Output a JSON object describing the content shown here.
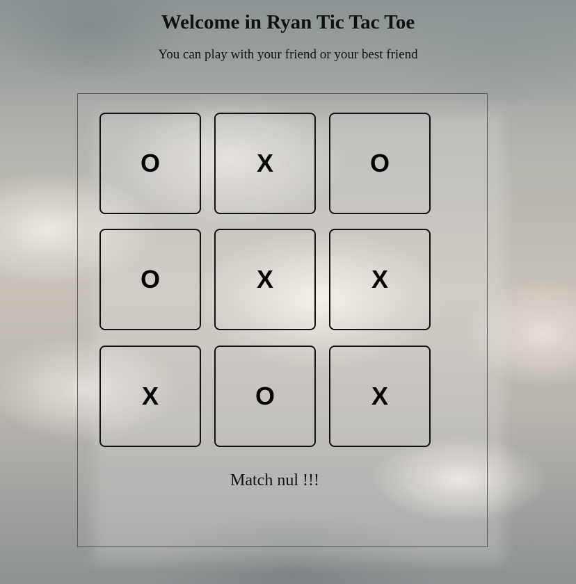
{
  "header": {
    "title": "Welcome in Ryan Tic Tac Toe",
    "subtitle": "You can play with your friend or your best friend"
  },
  "board": {
    "cells": [
      "O",
      "X",
      "O",
      "O",
      "X",
      "X",
      "X",
      "O",
      "X"
    ]
  },
  "status": {
    "message": "Match nul !!!"
  }
}
